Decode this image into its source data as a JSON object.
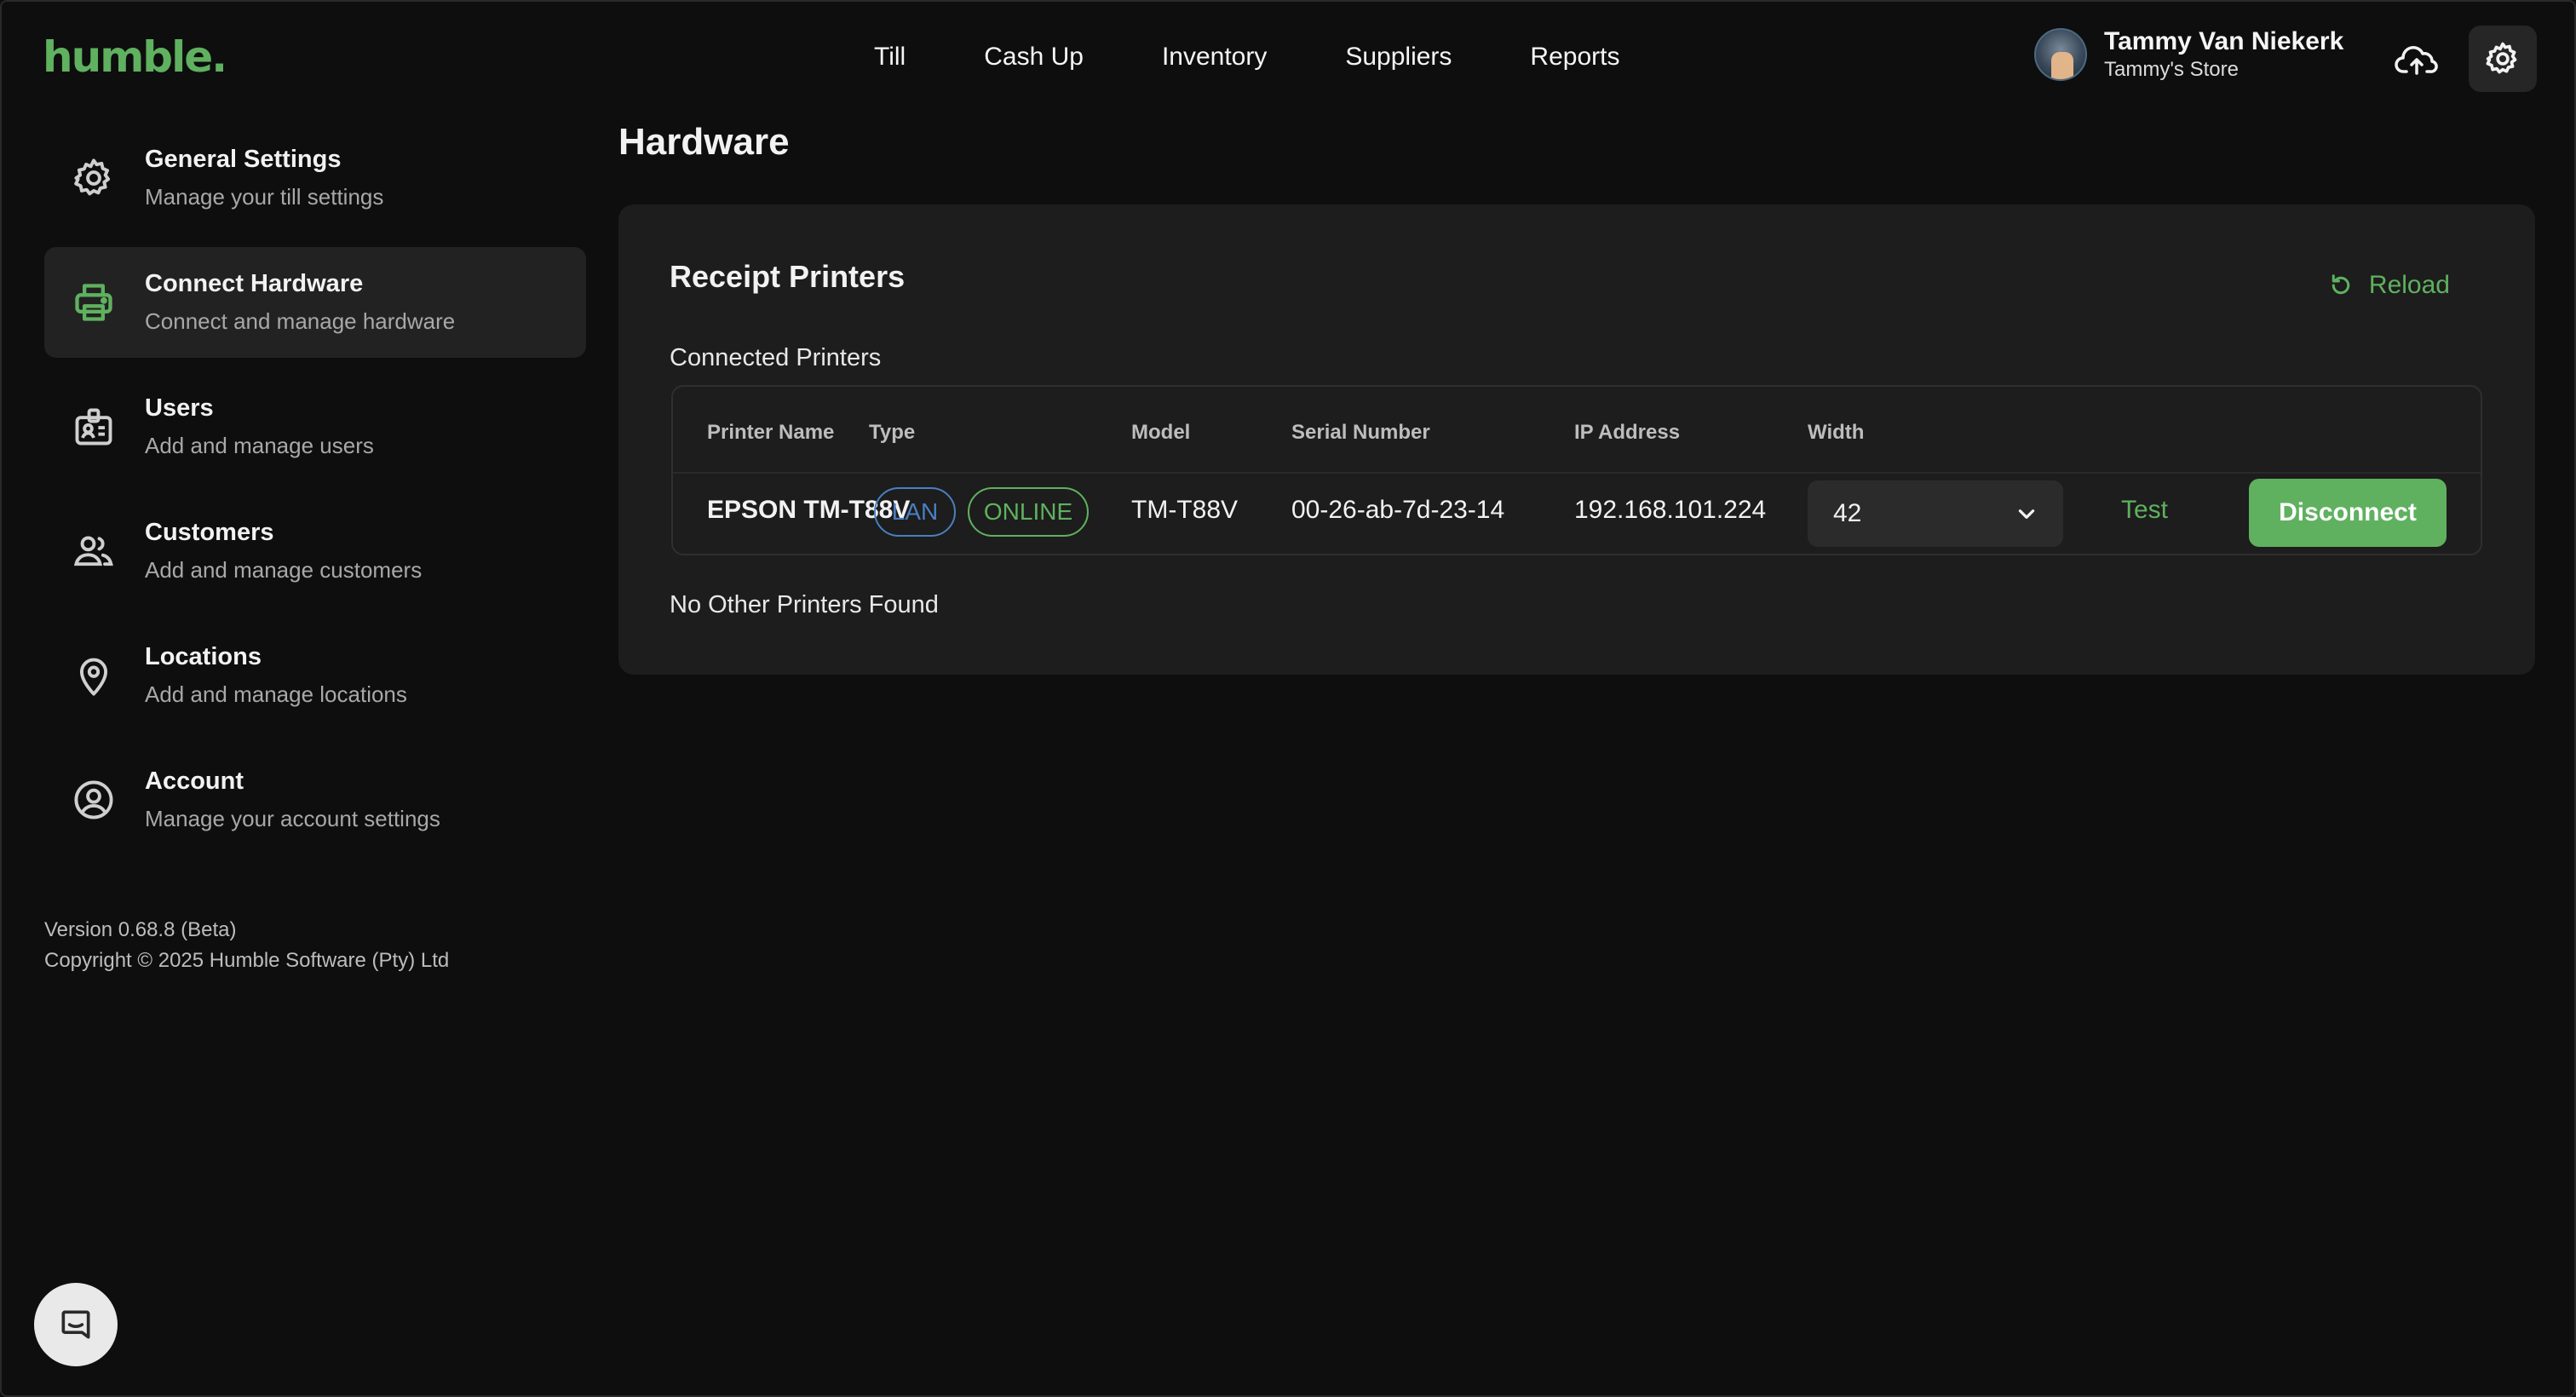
{
  "app": {
    "logo": "humble."
  },
  "topnav": {
    "items": [
      {
        "label": "Till"
      },
      {
        "label": "Cash Up"
      },
      {
        "label": "Inventory"
      },
      {
        "label": "Suppliers"
      },
      {
        "label": "Reports"
      }
    ]
  },
  "user": {
    "name": "Tammy Van Niekerk",
    "store": "Tammy's Store"
  },
  "sidebar": {
    "items": [
      {
        "title": "General Settings",
        "subtitle": "Manage your till settings",
        "icon": "gear-icon"
      },
      {
        "title": "Connect Hardware",
        "subtitle": "Connect and manage hardware",
        "icon": "printer-icon",
        "active": true
      },
      {
        "title": "Users",
        "subtitle": "Add and manage users",
        "icon": "id-badge-icon"
      },
      {
        "title": "Customers",
        "subtitle": "Add and manage customers",
        "icon": "people-icon"
      },
      {
        "title": "Locations",
        "subtitle": "Add and manage locations",
        "icon": "location-pin-icon"
      },
      {
        "title": "Account",
        "subtitle": "Manage your account settings",
        "icon": "account-circle-icon"
      }
    ],
    "version": "Version 0.68.8 (Beta)",
    "copyright": "Copyright © 2025 Humble Software (Pty) Ltd"
  },
  "main": {
    "page_title": "Hardware",
    "card": {
      "title": "Receipt Printers",
      "reload_label": "Reload",
      "connected_label": "Connected Printers",
      "columns": [
        "Printer Name",
        "Type",
        "Model",
        "Serial Number",
        "IP Address",
        "Width"
      ],
      "rows": [
        {
          "printer_name": "EPSON TM-T88V",
          "type": "LAN",
          "status": "ONLINE",
          "model": "TM-T88V",
          "serial": "00-26-ab-7d-23-14",
          "ip": "192.168.101.224",
          "width": "42",
          "test_label": "Test",
          "disconnect_label": "Disconnect"
        }
      ],
      "no_other": "No Other Printers Found"
    }
  },
  "colors": {
    "accent": "#5fb15f",
    "lan_blue": "#4a7fc0",
    "background": "#0e0e0e",
    "card": "#1d1d1d"
  }
}
